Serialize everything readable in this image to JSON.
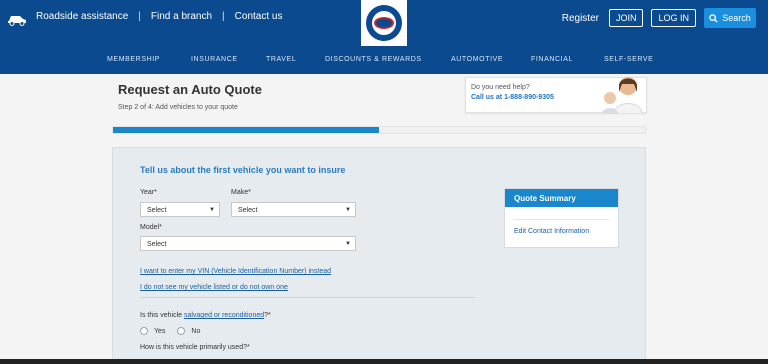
{
  "header": {
    "links": [
      "Roadside assistance",
      "Find a branch",
      "Contact us"
    ],
    "register": "Register",
    "join": "JOIN",
    "login": "LOG IN",
    "search": "Search"
  },
  "nav": [
    "MEMBERSHIP",
    "INSURANCE",
    "TRAVEL",
    "DISCOUNTS & REWARDS",
    "AUTOMOTIVE",
    "FINANCIAL",
    "SELF-SERVE"
  ],
  "page": {
    "title": "Request an Auto Quote",
    "step": "Step 2 of 4: Add vehicles to your quote",
    "progress_percent": 50
  },
  "help": {
    "question": "Do you need help?",
    "phone": "Call us at 1-888-890-9305"
  },
  "form": {
    "title": "Tell us about the first  vehicle you want to insure",
    "year_label": "Year*",
    "make_label": "Make*",
    "model_label": "Model*",
    "year_value": "Select",
    "make_value": "Select",
    "model_value": "Select",
    "vin_link": "I want to enter my VIN (Vehicle Identification Number) instead",
    "notlisted_link": "I do not see my vehicle listed or do not own one",
    "salvaged_prefix": "Is this vehicle ",
    "salvaged_link": "salvaged or reconditioned",
    "salvaged_suffix": "?*",
    "yes": "Yes",
    "no": "No",
    "usage_label": "How is this vehicle primarily used?*"
  },
  "summary": {
    "title": "Quote Summary",
    "edit": "Edit Contact Information"
  },
  "colors": {
    "brand": "#0b4a8f",
    "accent": "#1a86cc",
    "link": "#1a5fa8"
  }
}
